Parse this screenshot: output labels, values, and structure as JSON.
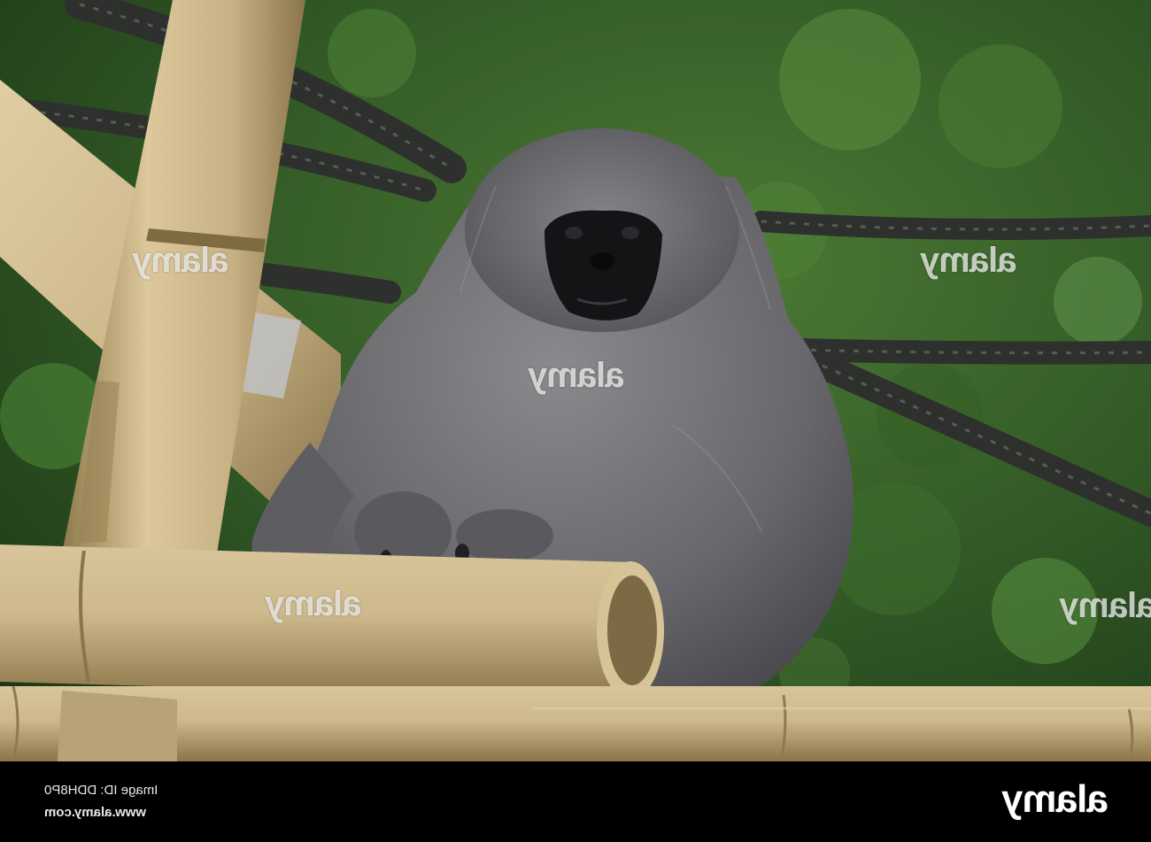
{
  "photo": {
    "subject": "gibbon-on-bamboo",
    "colors": {
      "foliage_dark": "#1f3a18",
      "foliage_mid": "#355f28",
      "foliage_light": "#5f8f3f",
      "bamboo": "#c9b487",
      "bamboo_shadow": "#8e7a50",
      "fur": "#6f6f72",
      "fur_dark": "#3f3f43",
      "face": "#111114",
      "rope": "#3b3d3b"
    }
  },
  "watermark": {
    "text": "alamy",
    "big_positions": [
      "tl",
      "center",
      "right",
      "lower-center",
      "lower-right"
    ]
  },
  "footer": {
    "image_id_line": "Image ID: DDH8P0",
    "site_line": "www.alamy.com",
    "logo_text": "alamy"
  }
}
